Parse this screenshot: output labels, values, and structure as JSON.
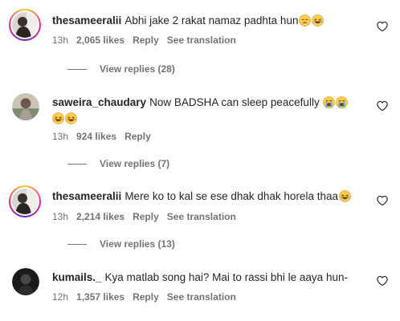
{
  "comments": [
    {
      "username": "thesameeralii",
      "text": "Abhi jake 2 rakat namaz padhta hun",
      "emojis": [
        "neutral-face-emoji",
        "laughing-face-emoji"
      ],
      "time": "13h",
      "likes": "2,065 likes",
      "reply": "Reply",
      "translate": "See translation",
      "view_replies": "View replies (28)",
      "avatar": "story-ring"
    },
    {
      "username": "saweira_chaudary",
      "text": "Now BADSHA can sleep peacefully",
      "emojis": [
        "crying-face-emoji",
        "crying-face-emoji",
        "laughing-face-emoji",
        "laughing-face-emoji"
      ],
      "time": "13h",
      "likes": "924 likes",
      "reply": "Reply",
      "view_replies": "View replies (7)",
      "avatar": "plain"
    },
    {
      "username": "thesameeralii",
      "text": "Mere ko to kal se ese dhak dhak horela thaa",
      "emojis": [
        "laughing-face-emoji"
      ],
      "time": "13h",
      "likes": "2,214 likes",
      "reply": "Reply",
      "translate": "See translation",
      "view_replies": "View replies (13)",
      "avatar": "story-ring"
    },
    {
      "username": "kumails._",
      "text": "Kya matlab song hai? Mai to rassi bhi le aaya hun-",
      "time": "12h",
      "likes": "1,357 likes",
      "reply": "Reply",
      "translate": "See translation",
      "avatar": "plain"
    }
  ],
  "colors": {
    "text": "#262626",
    "muted": "#737373",
    "story_ring": "#ee2a7b"
  },
  "icons": {
    "like": "heart-outline-icon"
  }
}
